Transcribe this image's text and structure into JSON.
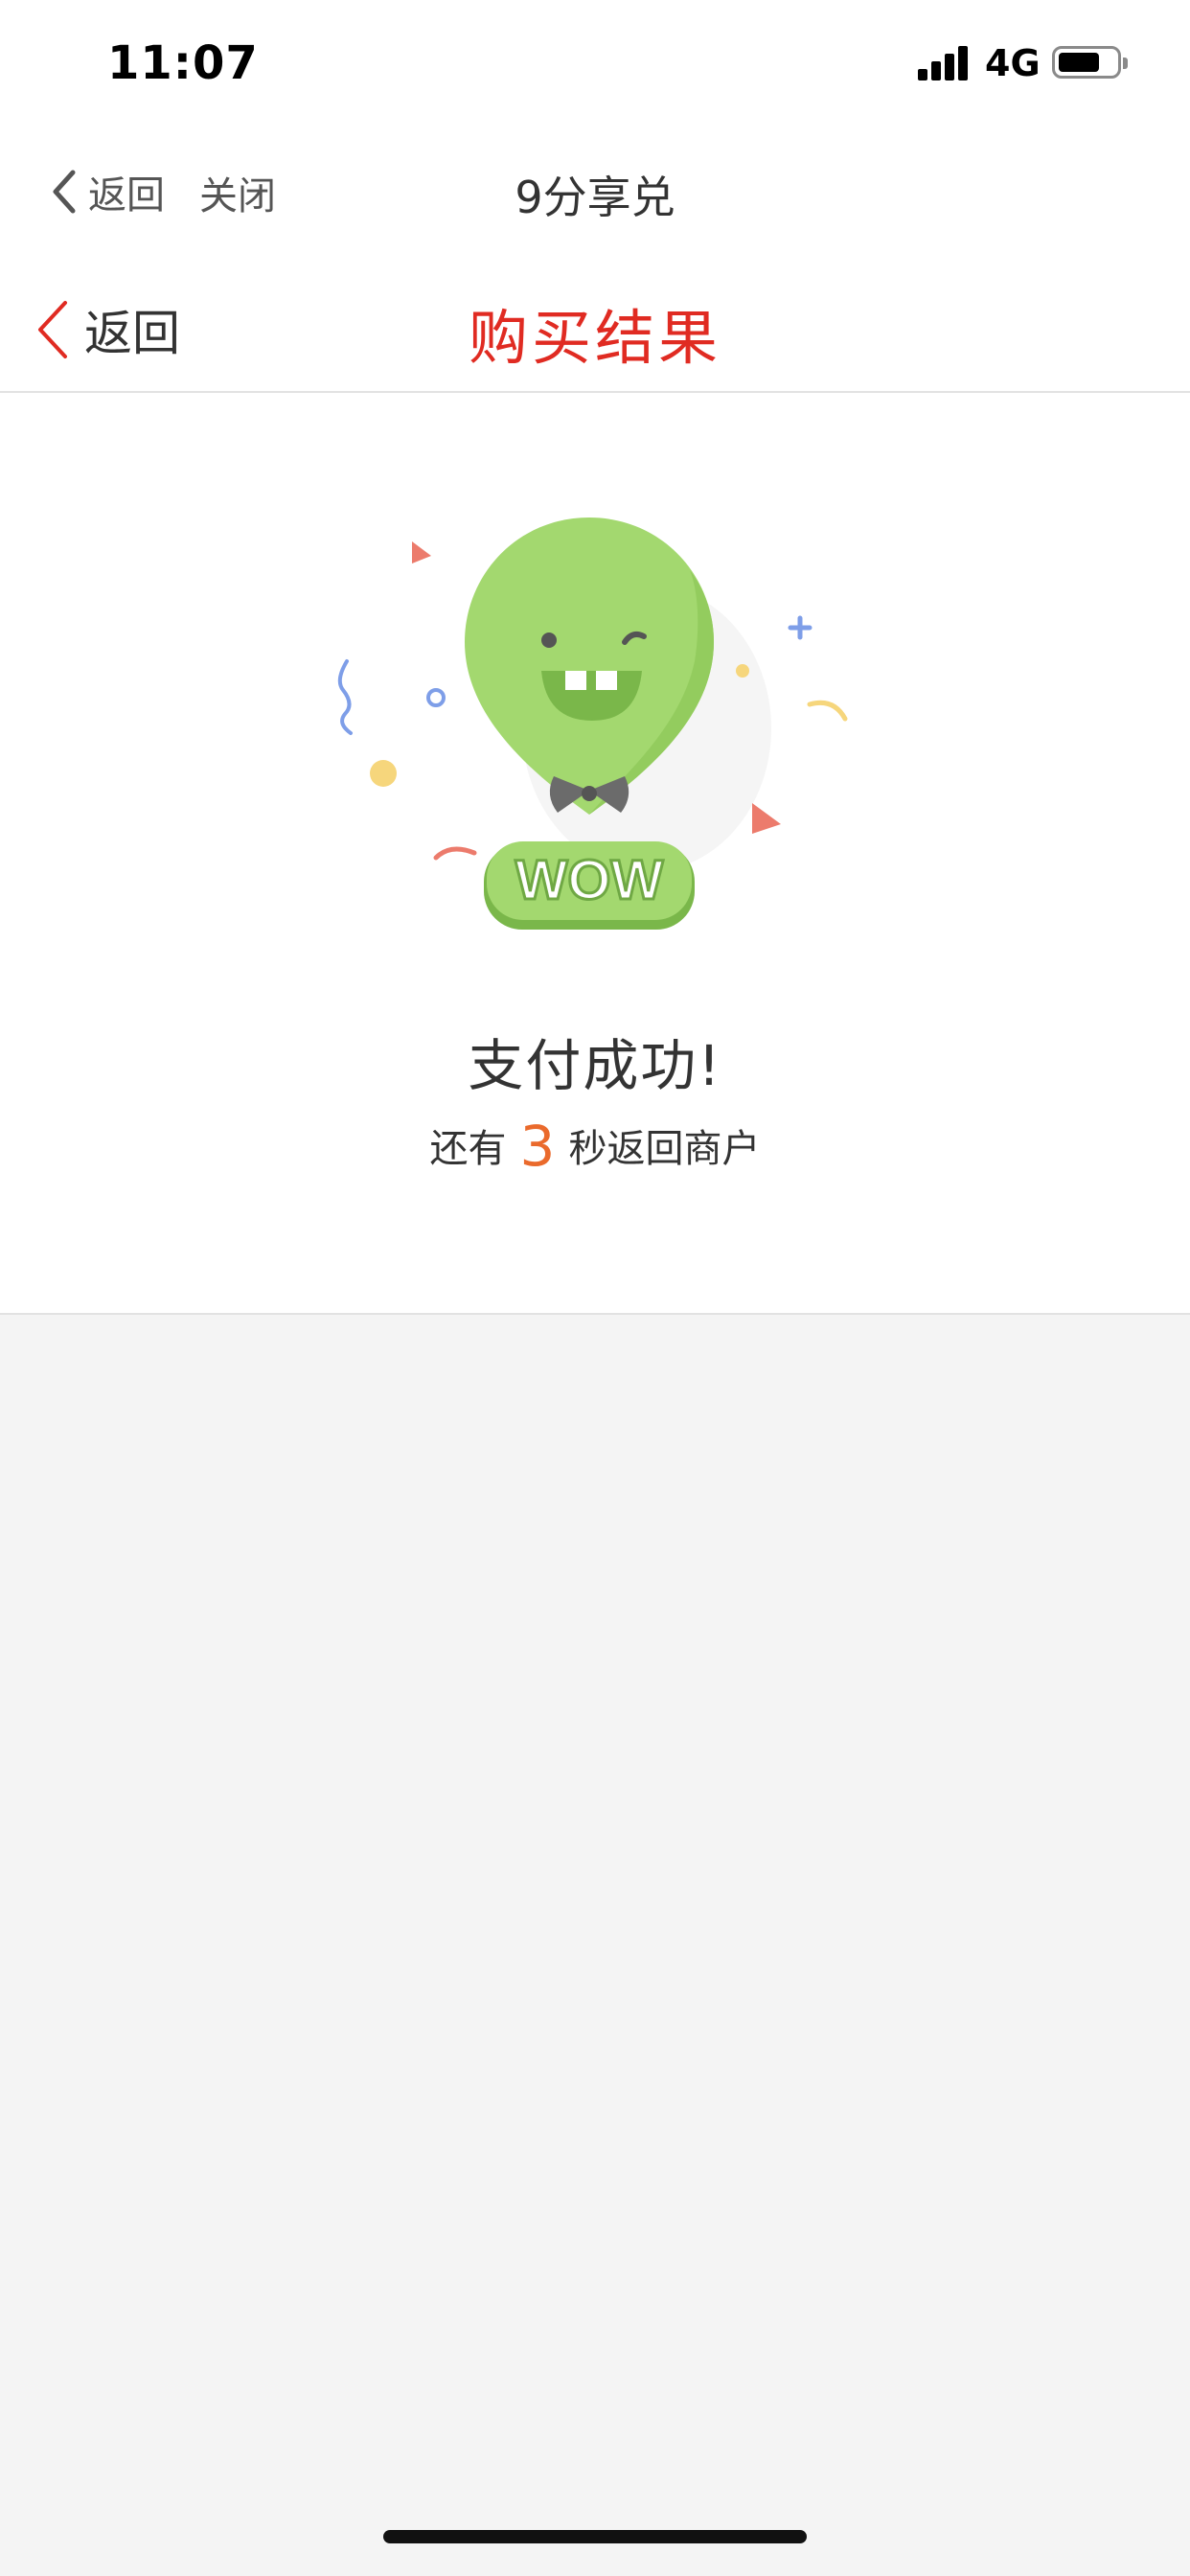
{
  "status_bar": {
    "time": "11:07",
    "network": "4G",
    "battery_level": 0.7
  },
  "outer_nav": {
    "back_label": "返回",
    "close_label": "关闭",
    "title": "9分享兑"
  },
  "inner_header": {
    "back_label": "返回",
    "title": "购买结果"
  },
  "illustration": {
    "badge_text": "WOW",
    "colors": {
      "balloon": "#a3d86f",
      "balloon_dark": "#7ab74a",
      "accent_red": "#ec7b6c",
      "accent_blue": "#7e9ee8",
      "accent_yellow": "#f6d67c"
    }
  },
  "result": {
    "message": "支付成功!",
    "countdown_prefix": "还有",
    "countdown_seconds": "3",
    "countdown_suffix": "秒返回商户"
  },
  "colors": {
    "title_red": "#e02b22",
    "countdown_orange": "#ea6a2c",
    "page_bg": "#f4f4f4"
  }
}
